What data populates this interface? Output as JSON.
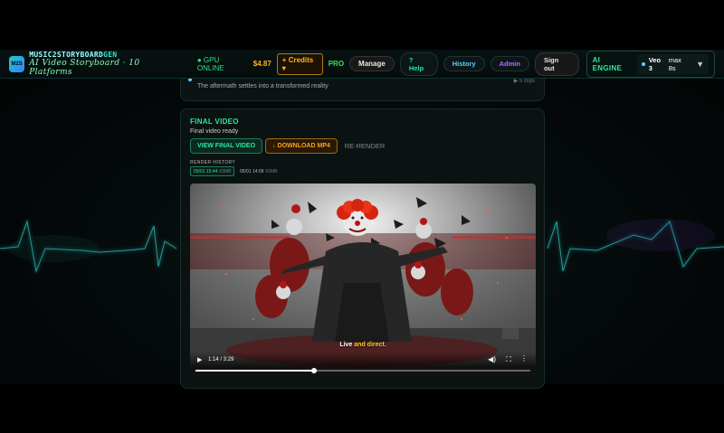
{
  "header": {
    "logo_text": "M2S",
    "brand_part1": "MUSIC2STORYBOARD",
    "brand_part2": "GEN",
    "subtitle": "AI Video Storyboard · 10 Platforms",
    "gpu_status": "● GPU ONLINE",
    "balance": "$4.87",
    "credits_label": "+ Credits ▾",
    "plan": "PRO",
    "manage_label": "Manage",
    "help_label": "? Help",
    "history_label": "History",
    "admin_label": "Admin",
    "signout_label": "Sign out",
    "engine_label": "AI ENGINE",
    "engine_model": "Veo 3",
    "engine_max": "max 8s",
    "engine_caret": "▼"
  },
  "previous_card": {
    "text": "The aftermath settles into a transformed reality",
    "clips": "▶ 5 clips"
  },
  "final_video": {
    "title": "FINAL VIDEO",
    "status": "Final video ready",
    "view_label": "VIEW FINAL VIDEO",
    "download_label": "↓ DOWNLOAD MP4",
    "rerender_label": "RE-RENDER",
    "render_history_label": "RENDER HISTORY",
    "history": [
      {
        "date": "05/01 15:44",
        "size": "63MB"
      },
      {
        "date": "05/01 14:09",
        "size": "60MB"
      }
    ]
  },
  "player": {
    "subtitle_1": "Live",
    "subtitle_2": "and direct.",
    "play_icon": "▶",
    "time": "1:14 / 3:29",
    "volume_icon": "◀)",
    "fullscreen_icon": "⛶",
    "more_icon": "⋮",
    "progress": 0.354
  },
  "colors": {
    "accent_green": "#2ee6a0",
    "accent_orange": "#ffa31c",
    "accent_purple": "#b86bff",
    "accent_blue": "#5ad1ff"
  }
}
